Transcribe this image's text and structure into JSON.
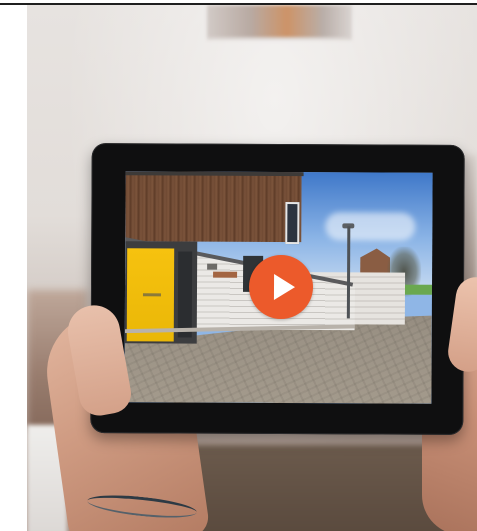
{
  "page": {
    "background_color": "#ffffff",
    "rule_color": "#1f1f1f"
  },
  "video": {
    "play_button": {
      "icon": "play-icon",
      "color": "#ec5a2b",
      "icon_color": "#ffffff"
    }
  }
}
